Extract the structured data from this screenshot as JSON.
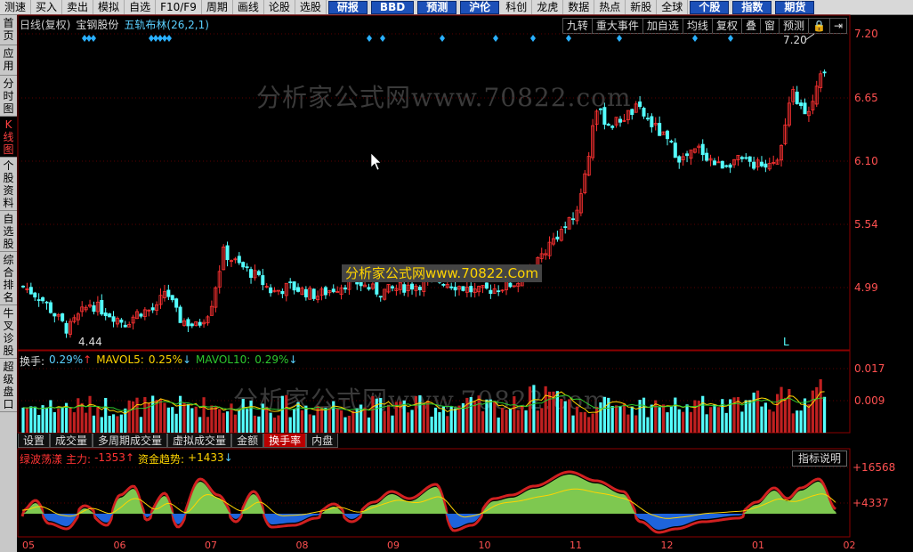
{
  "menu": [
    "测速",
    "买入",
    "卖出",
    "模拟",
    "自选",
    "F10/F9",
    "周期",
    "画线",
    "论股",
    "选股",
    "研报",
    "BBD",
    "预测",
    "沪伦",
    "科创",
    "龙虎",
    "数据",
    "热点",
    "新股",
    "全球",
    "个股",
    "指数",
    "期货"
  ],
  "menu_highlight": [
    "研报",
    "BBD",
    "预测",
    "沪伦",
    "个股",
    "指数",
    "期货"
  ],
  "left_tabs": [
    {
      "label": "首页",
      "active": false,
      "red": false
    },
    {
      "label": "应用",
      "active": false,
      "red": false
    },
    {
      "label": "分时图",
      "active": false,
      "red": false
    },
    {
      "label": "K线图",
      "active": true,
      "red": true
    },
    {
      "label": "个股资料",
      "active": false,
      "red": false
    },
    {
      "label": "自选股",
      "active": false,
      "red": false
    },
    {
      "label": "综合排名",
      "active": false,
      "red": false
    },
    {
      "label": "牛叉诊股",
      "active": false,
      "red": false
    },
    {
      "label": "超级盘口",
      "active": false,
      "red": false
    }
  ],
  "chart_header": {
    "period": "日线(复权)",
    "stock": "宝钢股份",
    "indicator": "五轨布林(26,2,1)"
  },
  "chart_tools": [
    "九转",
    "重大事件",
    "加自选",
    "均线",
    "复权",
    "叠",
    "窗",
    "预测",
    "🔒",
    "⇥"
  ],
  "price_axis": [
    "7.20",
    "6.65",
    "6.10",
    "5.54",
    "4.99"
  ],
  "price_high_label": "7.20",
  "price_low_label": "4.44",
  "l_marker": "L",
  "watermark": "分析家公式网www.70822.com",
  "banner": "分析家公式网www.70822.Com",
  "volume_header": {
    "name": "换手:",
    "value": "0.29%",
    "ma5_label": "MAVOL5:",
    "ma5_value": "0.25%",
    "ma10_label": "MAVOL10:",
    "ma10_value": "0.29%"
  },
  "volume_axis": [
    "0.017",
    "0.009"
  ],
  "volume_tabs": [
    "设置",
    "成交量",
    "多周期成交量",
    "虚拟成交量",
    "金额",
    "换手率",
    "内盘"
  ],
  "volume_tab_active": "换手率",
  "indicator_header": {
    "name": "绿波荡漾",
    "main_label": "主力:",
    "main_value": "-1353",
    "trend_label": "资金趋势:",
    "trend_value": "+1433"
  },
  "indicator_axis": [
    "+16568",
    "+4337"
  ],
  "indicator_button": "指标说明",
  "date_axis": [
    "05",
    "06",
    "07",
    "08",
    "09",
    "10",
    "11",
    "12",
    "01",
    "02"
  ],
  "colors": {
    "up": "#ff3232",
    "down": "#54ffff",
    "accent": "#1c50b8",
    "green_area": "#7ec850",
    "blue_area": "#1e64dc"
  }
}
